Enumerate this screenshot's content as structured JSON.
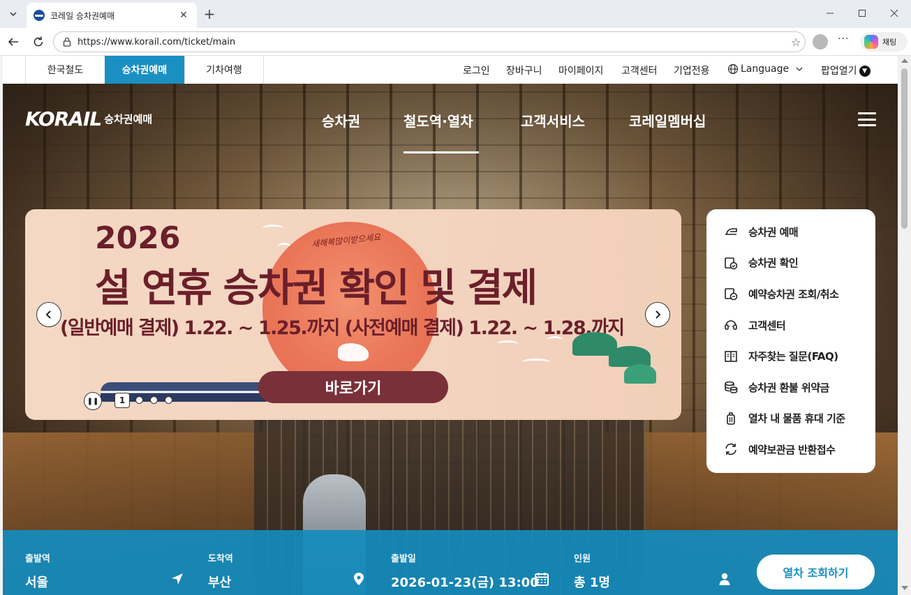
{
  "browser": {
    "tab_title": "코레일 승차권예매",
    "url": "https://www.korail.com/ticket/main",
    "chat_label": "채팅"
  },
  "site_tabs": [
    {
      "label": "한국철도"
    },
    {
      "label": "승차권예매",
      "active": true
    },
    {
      "label": "기차여행"
    }
  ],
  "utility_links": {
    "login": "로그인",
    "cart": "장바구니",
    "mypage": "마이페이지",
    "customer_center": "고객센터",
    "corporate": "기업전용",
    "language": "Language",
    "popup": "팝업열기"
  },
  "logo": {
    "brand": "KORAIL",
    "sub": "승차권예매"
  },
  "gnb": [
    "승차권",
    "철도역·열차",
    "고객서비스",
    "코레일멤버십"
  ],
  "gnb_active_index": 1,
  "banner": {
    "year": "2026",
    "title": "설 연휴 승차권 확인 및 결제",
    "subtitle": "(일반예매 결제) 1.22. ~ 1.25.까지  (사전예매 결제) 1.22. ~ 1.28.까지",
    "script_text": "새해복많이받으세요",
    "cta": "바로가기",
    "page_number": "1"
  },
  "quick_menu": [
    {
      "label": "승차권 예매",
      "icon": "ticket-icon"
    },
    {
      "label": "승차권 확인",
      "icon": "ticket-check-icon"
    },
    {
      "label": "예약승차권 조회/취소",
      "icon": "ticket-search-icon"
    },
    {
      "label": "고객센터",
      "icon": "headset-icon"
    },
    {
      "label": "자주찾는 질문(FAQ)",
      "icon": "book-icon"
    },
    {
      "label": "승차권 환불 위약금",
      "icon": "coins-icon"
    },
    {
      "label": "열차 내 물품 휴대 기준",
      "icon": "luggage-icon"
    },
    {
      "label": "예약보관금 반환접수",
      "icon": "refresh-icon"
    }
  ],
  "search": {
    "departure_label": "출발역",
    "departure_value": "서울",
    "arrival_label": "도착역",
    "arrival_value": "부산",
    "date_label": "출발일",
    "date_value": "2026-01-23(금) 13:00",
    "passengers_label": "인원",
    "passengers_value": "총 1명",
    "submit": "열차 조회하기"
  },
  "colors": {
    "accent": "#1a8fc2",
    "banner_text": "#6b1f2a",
    "cta": "#7a3038"
  }
}
